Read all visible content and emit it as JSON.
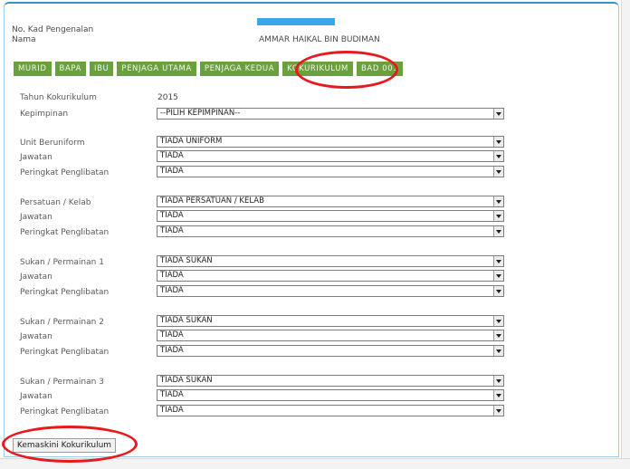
{
  "header": {
    "ic_label": "No. Kad Pengenalan",
    "name_label": "Nama",
    "name_value": "AMMAR HAIKAL BIN BUDIMAN"
  },
  "tabs": [
    "MURID",
    "BAPA",
    "IBU",
    "PENJAGA UTAMA",
    "PENJAGA KEDUA",
    "KOKURIKULUM",
    "BAD 001"
  ],
  "form": {
    "year_label": "Tahun Kokurikulum",
    "year_value": "2015",
    "leadership_label": "Kepimpinan",
    "leadership_value": "--PILIH KEPIMPINAN--",
    "unit_label": "Unit Beruniform",
    "unit_value": "TIADA UNIFORM",
    "position_label": "Jawatan",
    "level_label": "Peringkat Penglibatan",
    "none_value": "TIADA",
    "club_label": "Persatuan / Kelab",
    "club_value": "TIADA PERSATUAN / KELAB",
    "sport1_label": "Sukan / Permainan 1",
    "sport2_label": "Sukan / Permainan 2",
    "sport3_label": "Sukan / Permainan 3",
    "sport_value": "TIADA SUKAN"
  },
  "update_button": "Kemaskini Kokurikulum",
  "colors": {
    "tab_green": "#6ba03e",
    "highlight_red": "#e8181c",
    "frame_blue": "#3d8fc8"
  }
}
